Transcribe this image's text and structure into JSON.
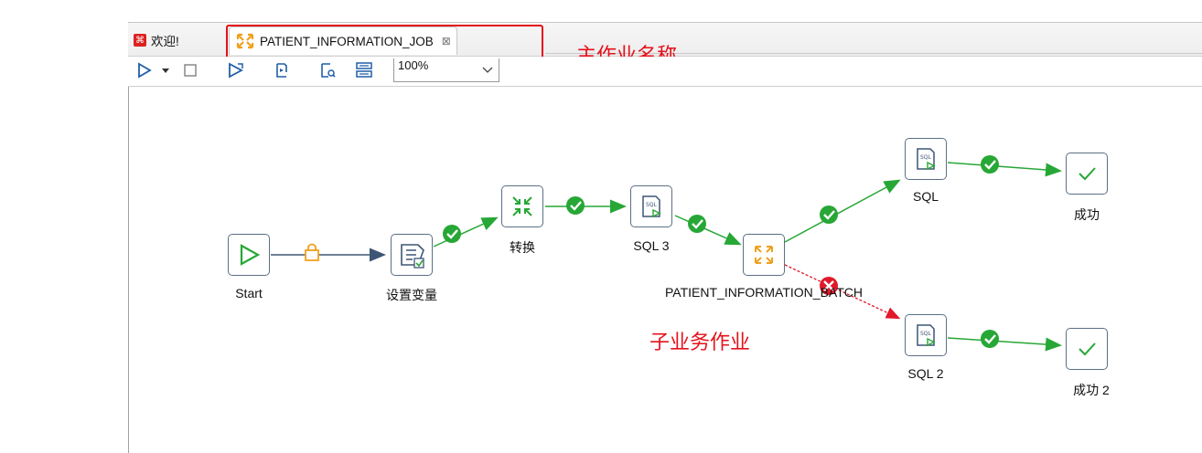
{
  "tabs": {
    "welcome_label": "欢迎!",
    "job_label": "PATIENT_INFORMATION_JOB",
    "job_close": "⊠"
  },
  "toolbar": {
    "zoom_value": "100%"
  },
  "annotations": {
    "main_job_name": "主作业名称",
    "sub_job": "子业务作业"
  },
  "nodes": {
    "start": "Start",
    "set_vars": "设置变量",
    "transform": "转换",
    "sql3": "SQL 3",
    "batch": "PATIENT_INFORMATION_BATCH",
    "sql": "SQL",
    "success": "成功",
    "sql2": "SQL 2",
    "success2": "成功 2"
  },
  "colors": {
    "annotation": "#e4111b",
    "hop_ok": "#27a736",
    "hop_fail": "#e0182a",
    "hop_unconditional": "#3d5675",
    "node_border": "#5b6f86",
    "lock": "#f0a01c"
  }
}
